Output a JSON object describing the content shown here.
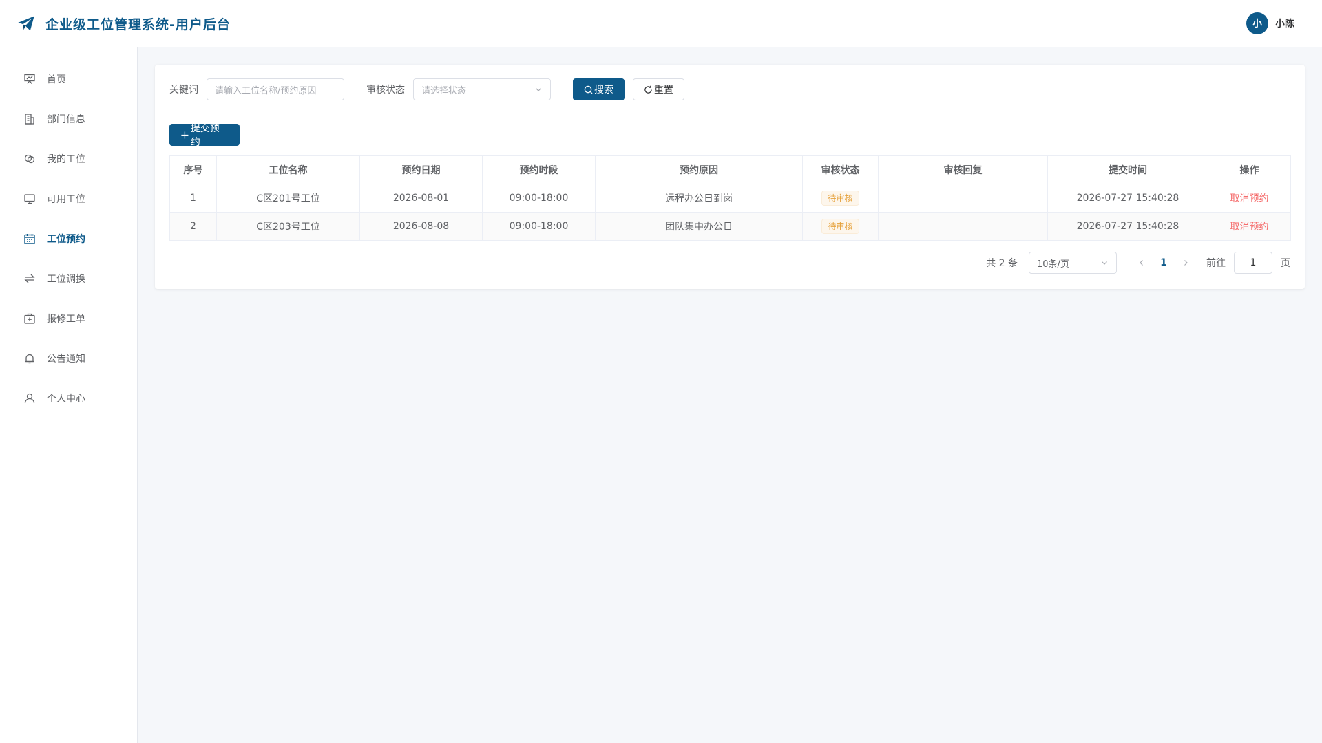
{
  "header": {
    "title": "企业级工位管理系统-用户后台",
    "user": {
      "avatar_text": "小",
      "name": "小陈"
    }
  },
  "sidebar": {
    "items": [
      {
        "label": "首页",
        "icon": "dashboard-icon"
      },
      {
        "label": "部门信息",
        "icon": "building-icon"
      },
      {
        "label": "我的工位",
        "icon": "link-icon"
      },
      {
        "label": "可用工位",
        "icon": "monitor-icon"
      },
      {
        "label": "工位预约",
        "icon": "calendar-icon",
        "active": true
      },
      {
        "label": "工位调换",
        "icon": "swap-icon"
      },
      {
        "label": "报修工单",
        "icon": "first-aid-icon"
      },
      {
        "label": "公告通知",
        "icon": "bell-icon"
      },
      {
        "label": "个人中心",
        "icon": "user-icon"
      }
    ]
  },
  "filters": {
    "keyword_label": "关键词",
    "keyword_placeholder": "请输入工位名称/预约原因",
    "status_label": "审核状态",
    "status_placeholder": "请选择状态",
    "search_label": "搜索",
    "reset_label": "重置"
  },
  "actions": {
    "add_label": "提交预约"
  },
  "table": {
    "headers": [
      "序号",
      "工位名称",
      "预约日期",
      "预约时段",
      "预约原因",
      "审核状态",
      "审核回复",
      "提交时间",
      "操作"
    ],
    "rows": [
      {
        "index": "1",
        "name": "C区201号工位",
        "date": "2026-08-01",
        "slot": "09:00-18:00",
        "reason": "远程办公日到岗",
        "status": "待审核",
        "reply": "",
        "submitted": "2026-07-27 15:40:28",
        "action": "取消预约"
      },
      {
        "index": "2",
        "name": "C区203号工位",
        "date": "2026-08-08",
        "slot": "09:00-18:00",
        "reason": "团队集中办公日",
        "status": "待审核",
        "reply": "",
        "submitted": "2026-07-27 15:40:28",
        "action": "取消预约"
      }
    ]
  },
  "pagination": {
    "total_text": "共 2 条",
    "page_size": "10条/页",
    "current_page": "1",
    "goto_label": "前往",
    "goto_value": "1",
    "page_suffix": "页"
  },
  "colors": {
    "brand": "#0e5a8a",
    "warning": "#e6a23c",
    "danger": "#f56c6c"
  }
}
